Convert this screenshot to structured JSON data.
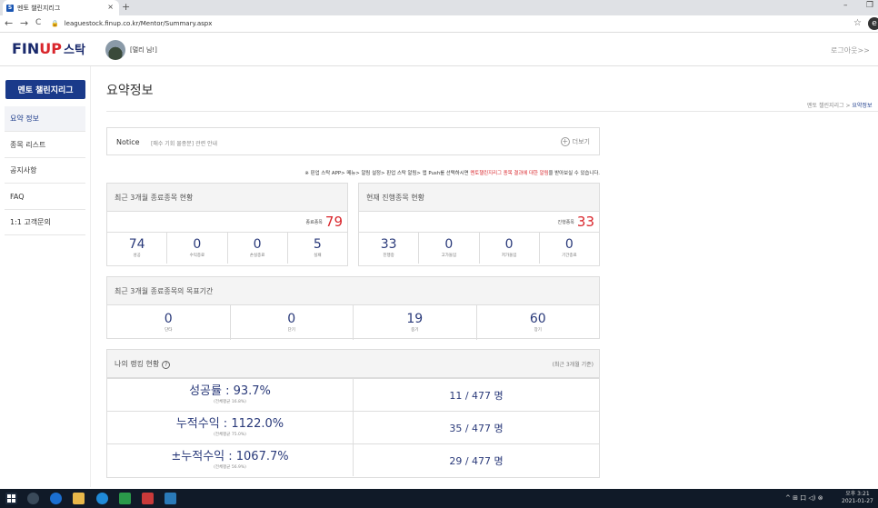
{
  "browser": {
    "tab_title": "멘토 챌린지리그",
    "tab_favicon": "S",
    "tab_close": "×",
    "new_tab": "+",
    "minimize": "–",
    "maximize": "❐",
    "url": "leaguestock.finup.co.kr/Mentor/Summary.aspx",
    "back": "←",
    "forward": "→",
    "reload": "C",
    "lock": "🔒",
    "star": "☆",
    "profile": "e"
  },
  "header": {
    "logo_fin": "FIN",
    "logo_up": "UP",
    "logo_kor": "스탁",
    "user": "[멀리 님!]",
    "logout": "로그아웃>>"
  },
  "sidebar": {
    "title": "멘토 챌린지리그",
    "items": [
      {
        "label": "요약 정보"
      },
      {
        "label": "종목 리스트"
      },
      {
        "label": "공지사항"
      },
      {
        "label": "FAQ"
      },
      {
        "label": "1:1 고객문의"
      }
    ]
  },
  "main": {
    "title": "요약정보",
    "breadcrumb_parent": "멘토 챌린지리그 > ",
    "breadcrumb_current": "요약정보",
    "notice": {
      "label": "Notice",
      "text": "[매수 기회 물종분] 관련 안내",
      "more_icon": "+",
      "more": "더보기"
    },
    "info": {
      "prefix": "※ 핀업 스탁 APP> 메뉴> 알림 설정> 핀업 스탁 알림> 앱 Push를 선택하시면 ",
      "highlight": "멘토챌린지리그 종목 결과에 대한 알림",
      "suffix": "을 받아보실 수 있습니다."
    },
    "closed_3m": {
      "title": "최근 3개월 종료종목 현황",
      "total_label": "종료종목",
      "total": "79",
      "stats": [
        {
          "num": "74",
          "label": "성공"
        },
        {
          "num": "0",
          "label": "수익종료"
        },
        {
          "num": "0",
          "label": "손실종료"
        },
        {
          "num": "5",
          "label": "실패"
        }
      ]
    },
    "ongoing": {
      "title": "현재 진행종목 현황",
      "total_label": "진행종목",
      "total": "33",
      "stats": [
        {
          "num": "33",
          "label": "진행중"
        },
        {
          "num": "0",
          "label": "고가돌입"
        },
        {
          "num": "0",
          "label": "저가돌입"
        },
        {
          "num": "0",
          "label": "기간종료"
        }
      ]
    },
    "target_period": {
      "title": "최근 3개월 종료종목의 목표기간",
      "stats": [
        {
          "num": "0",
          "label": "단타"
        },
        {
          "num": "0",
          "label": "단기"
        },
        {
          "num": "19",
          "label": "중기"
        },
        {
          "num": "60",
          "label": "장기"
        }
      ]
    },
    "ranking": {
      "title": "나의 랭킹 현황",
      "help_icon": "?",
      "note": "(최근 3개월 기준)",
      "rows": [
        {
          "metric": "성공률 : 93.7%",
          "avg": "(전체평균 16.8%)",
          "rank": "11 / 477 명"
        },
        {
          "metric": "누적수익 : 1122.0%",
          "avg": "(전체평균 75.0%)",
          "rank": "35 / 477 명"
        },
        {
          "metric": "±누적수익 : 1067.7%",
          "avg": "(전체평균 56.9%)",
          "rank": "29 / 477 명"
        }
      ]
    }
  },
  "taskbar": {
    "tray": "^ ⊞ 口 ◁) ⊗",
    "time": "오후 3:21",
    "date": "2021-01-27"
  },
  "colors": {
    "brand_navy": "#1a3a8a",
    "accent_red": "#d9262c",
    "number_blue": "#2a3a7a"
  }
}
